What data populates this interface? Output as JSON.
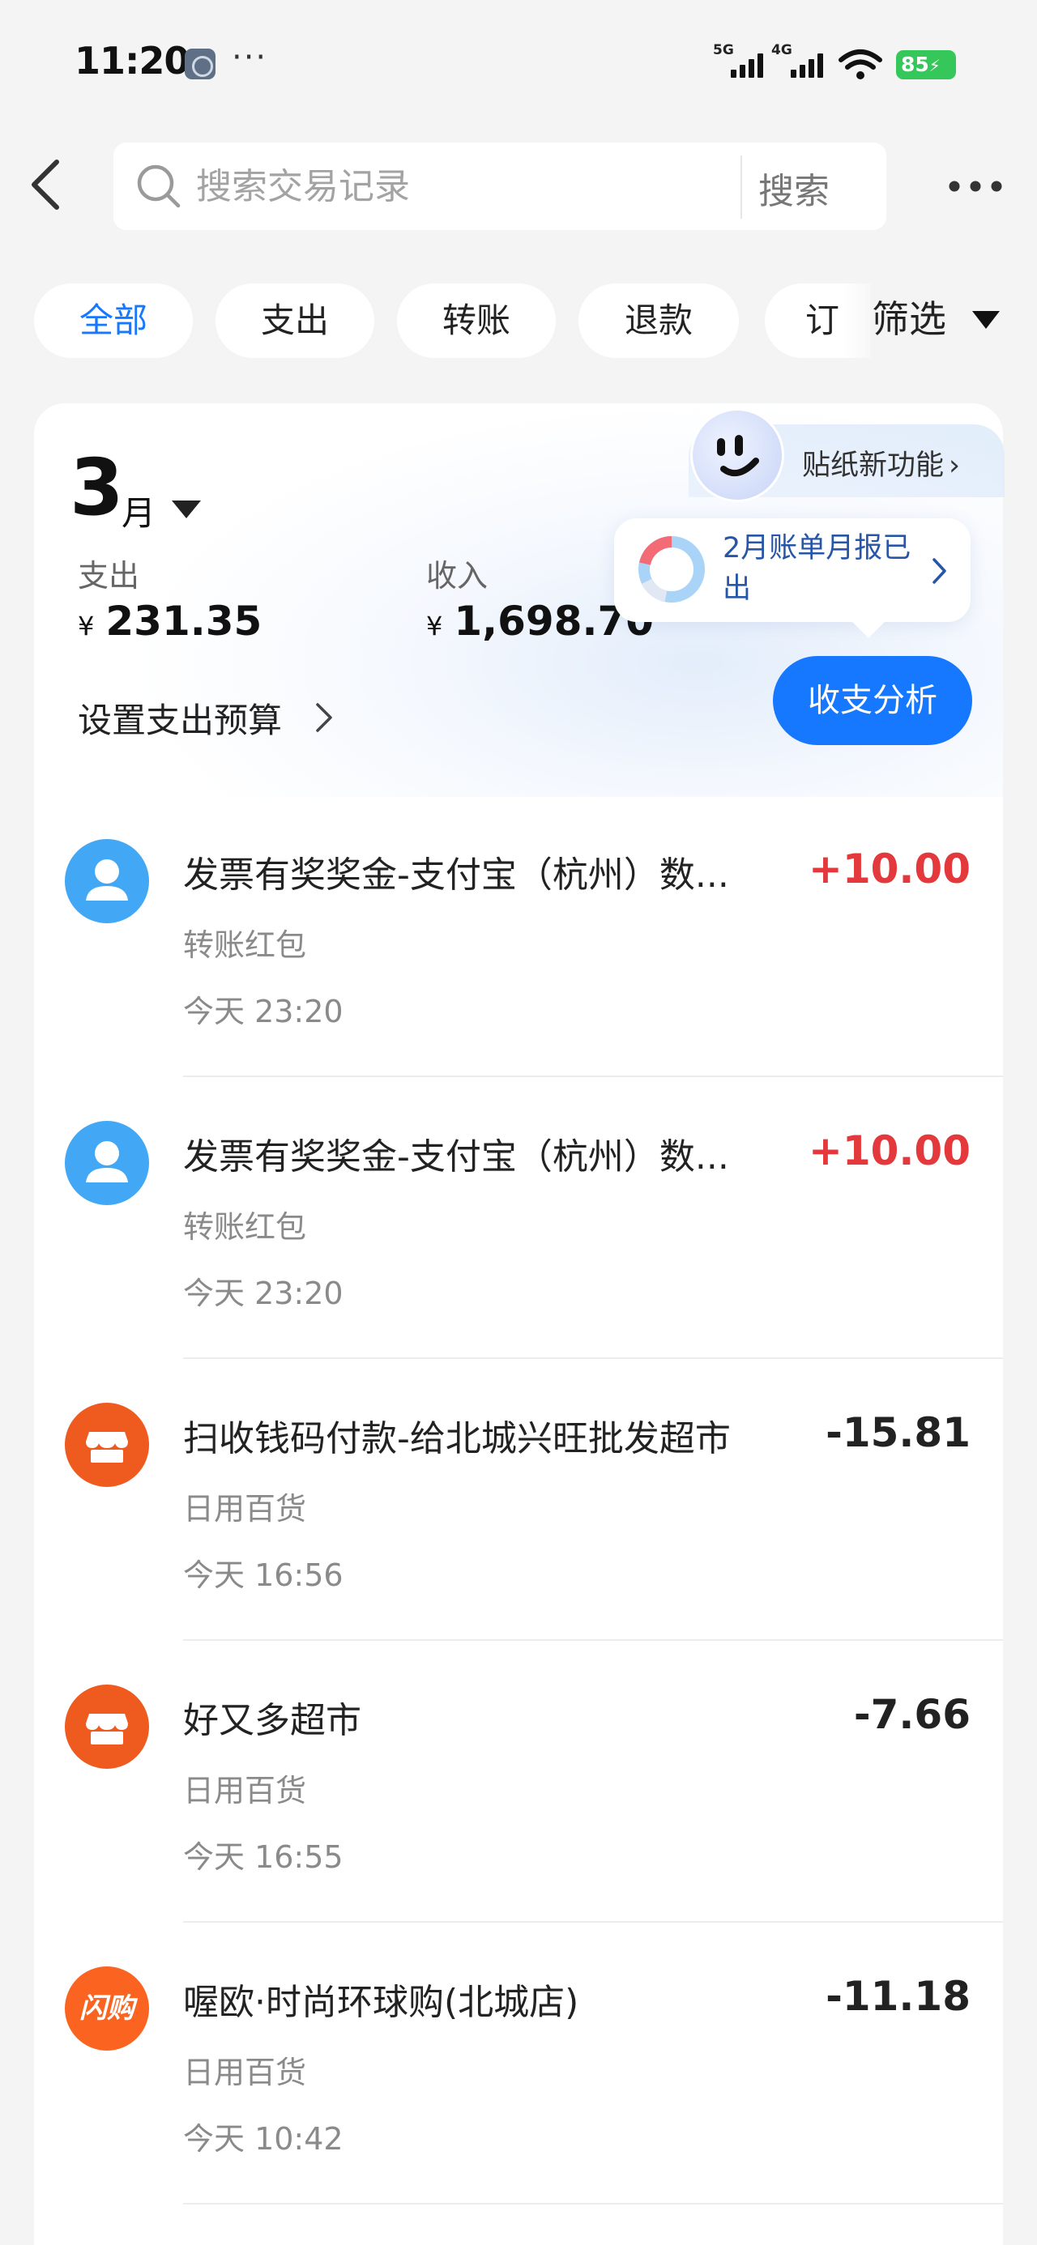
{
  "status_bar": {
    "time": "11:20",
    "dots": "···",
    "network_1": "5G",
    "network_2": "4G",
    "battery": "85"
  },
  "search": {
    "placeholder": "搜索交易记录",
    "button_label": "搜索"
  },
  "tabs": [
    {
      "label": "全部",
      "active": true
    },
    {
      "label": "支出",
      "active": false
    },
    {
      "label": "转账",
      "active": false
    },
    {
      "label": "退款",
      "active": false
    },
    {
      "label": "订单",
      "active": false
    }
  ],
  "filter_label": "筛选",
  "summary": {
    "sticker_label": "贴纸新功能",
    "month_number": "3",
    "month_unit": "月",
    "expense_label": "支出",
    "expense_currency": "¥",
    "expense_value": "231.35",
    "income_label": "收入",
    "income_currency": "¥",
    "income_value": "1,698.70",
    "bill_notice": "2月账单月报已出",
    "budget_link": "设置支出预算",
    "analysis_button": "收支分析"
  },
  "transactions": [
    {
      "title": "发票有奖奖金-支付宝（杭州）数...",
      "category": "转账红包",
      "time": "今天 23:20",
      "amount": "+10.00",
      "type": "income",
      "icon": "person-icon"
    },
    {
      "title": "发票有奖奖金-支付宝（杭州）数...",
      "category": "转账红包",
      "time": "今天 23:20",
      "amount": "+10.00",
      "type": "income",
      "icon": "person-icon"
    },
    {
      "title": "扫收钱码付款-给北城兴旺批发超市",
      "category": "日用百货",
      "time": "今天 16:56",
      "amount": "-15.81",
      "type": "expense",
      "icon": "shop-icon"
    },
    {
      "title": "好又多超市",
      "category": "日用百货",
      "time": "今天 16:55",
      "amount": "-7.66",
      "type": "expense",
      "icon": "shop-icon"
    },
    {
      "title": "喔欧·时尚环球购(北城店)",
      "category": "日用百货",
      "time": "今天 10:42",
      "amount": "-11.18",
      "type": "expense",
      "icon": "flash-buy-icon",
      "icon_text": "闪购"
    }
  ],
  "colors": {
    "accent": "#1677ff",
    "income": "#e4393c",
    "shop_icon": "#ef5a1f",
    "person_icon": "#42a7f5",
    "battery": "#35c759"
  }
}
